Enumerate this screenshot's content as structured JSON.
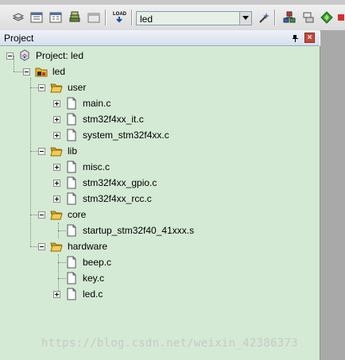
{
  "toolbar": {
    "target_value": "led",
    "icons": [
      "stack-icon",
      "grid-icon",
      "grid2-icon",
      "layers-icon",
      "window-icon",
      "load-icon",
      "wand-icon",
      "group-icon",
      "components-icon",
      "diamond-icon"
    ],
    "load_label": "LOAD"
  },
  "panel": {
    "title": "Project"
  },
  "tree": {
    "project": "Project: led",
    "target": "led",
    "groups": [
      {
        "name": "user",
        "files": [
          "main.c",
          "stm32f4xx_it.c",
          "system_stm32f4xx.c"
        ]
      },
      {
        "name": "lib",
        "files": [
          "misc.c",
          "stm32f4xx_gpio.c",
          "stm32f4xx_rcc.c"
        ]
      },
      {
        "name": "core",
        "files": [
          "startup_stm32f40_41xxx.s"
        ]
      },
      {
        "name": "hardware",
        "files": [
          "beep.c",
          "key.c",
          "led.c"
        ]
      }
    ]
  },
  "watermark": "https://blog.csdn.net/weixin_42386373",
  "colors": {
    "tree_bg": "#d4ead4",
    "folder": "#f0c040",
    "close_red": "#c8473a"
  }
}
